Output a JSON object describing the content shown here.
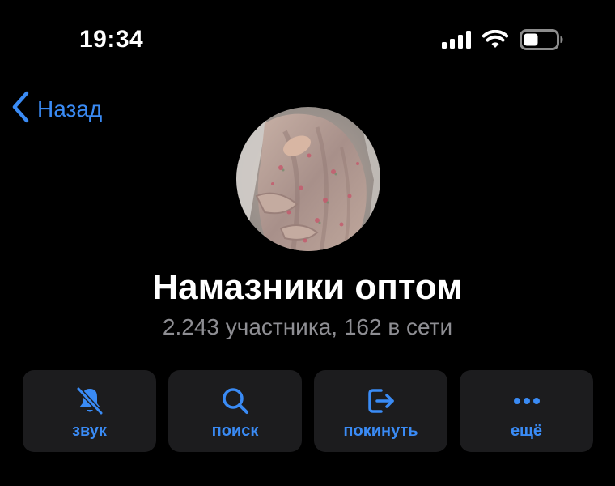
{
  "status_bar": {
    "time": "19:34"
  },
  "header": {
    "back_label": "Назад"
  },
  "profile": {
    "title": "Намазники оптом",
    "subtitle": "2.243 участника, 162 в сети"
  },
  "actions": [
    {
      "label": "звук",
      "icon": "bell-slash-icon"
    },
    {
      "label": "поиск",
      "icon": "search-icon"
    },
    {
      "label": "покинуть",
      "icon": "leave-icon"
    },
    {
      "label": "ещё",
      "icon": "more-icon"
    }
  ],
  "colors": {
    "background": "#000000",
    "accent": "#3a8bf5",
    "secondary_text": "#8e8e93",
    "button_bg": "#1c1c1e"
  }
}
